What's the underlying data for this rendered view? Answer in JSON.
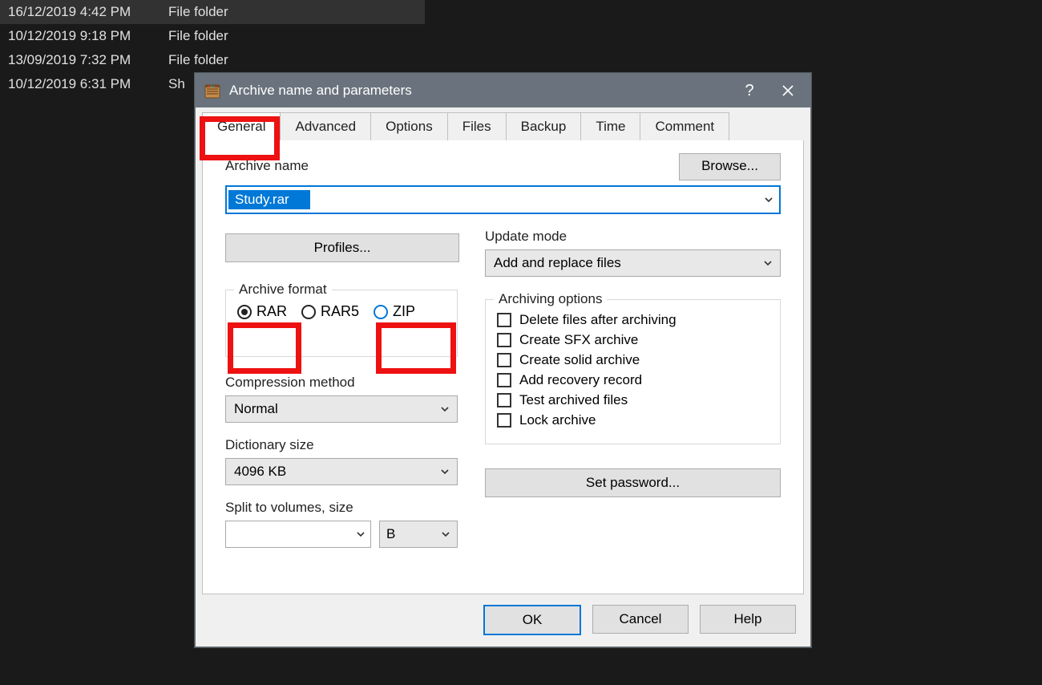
{
  "filesystem": {
    "rows": [
      {
        "date": "16/12/2019 4:42 PM",
        "type": "File folder",
        "selected": true
      },
      {
        "date": "10/12/2019 9:18 PM",
        "type": "File folder",
        "selected": false
      },
      {
        "date": "13/09/2019 7:32 PM",
        "type": "File folder",
        "selected": false
      },
      {
        "date": "10/12/2019 6:31 PM",
        "type": "Sh",
        "selected": false
      }
    ]
  },
  "dialog": {
    "title": "Archive name and parameters",
    "tabs": [
      "General",
      "Advanced",
      "Options",
      "Files",
      "Backup",
      "Time",
      "Comment"
    ],
    "active_tab_index": 0,
    "archive_name_label": "Archive name",
    "archive_name_value": "Study.rar",
    "browse_label": "Browse...",
    "profiles_label": "Profiles...",
    "update_mode_label": "Update mode",
    "update_mode_value": "Add and replace files",
    "archive_format_label": "Archive format",
    "formats": [
      {
        "label": "RAR",
        "selected": true
      },
      {
        "label": "RAR5",
        "selected": false
      },
      {
        "label": "ZIP",
        "selected": false
      }
    ],
    "compression_method_label": "Compression method",
    "compression_method_value": "Normal",
    "dictionary_size_label": "Dictionary size",
    "dictionary_size_value": "4096 KB",
    "split_label": "Split to volumes, size",
    "split_value": "",
    "split_unit": "B",
    "archiving_options_label": "Archiving options",
    "opts": [
      "Delete files after archiving",
      "Create SFX archive",
      "Create solid archive",
      "Add recovery record",
      "Test archived files",
      "Lock archive"
    ],
    "set_password_label": "Set password...",
    "ok_label": "OK",
    "cancel_label": "Cancel",
    "help_label": "Help"
  },
  "highlights": {
    "general_tab": true,
    "rar_radio": true,
    "zip_radio": true
  }
}
